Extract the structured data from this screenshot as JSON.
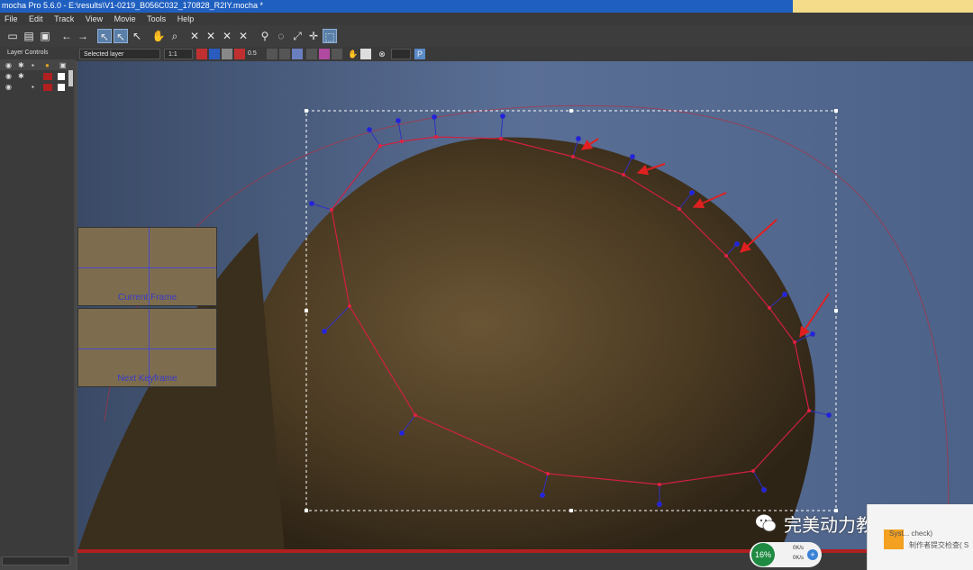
{
  "window": {
    "title": "mocha Pro 5.6.0 - E:\\results\\V1-0219_B056C032_170828_R2IY.mocha *"
  },
  "menu": [
    "File",
    "Edit",
    "Track",
    "View",
    "Movie",
    "Tools",
    "Help"
  ],
  "toolbar": {
    "layer_mode": "Selected layer",
    "zoom": "1:1",
    "opacity": "0.5",
    "p_button": "P"
  },
  "layer_controls": {
    "title": "Layer Controls"
  },
  "insets": {
    "current_frame": "Current Frame",
    "next_keyframe": "Next Keyframe"
  },
  "watermark": {
    "text": "完美动力教育"
  },
  "notification": {
    "line1": "Syst... check)",
    "line2": "制作者提交检查( S"
  },
  "speed_widget": {
    "percent": "16%",
    "upload": "0K/s",
    "download": "0K/s"
  },
  "icons": [
    "new-icon",
    "open-icon",
    "save-icon",
    "undo-icon",
    "redo-icon",
    "pick-icon",
    "select-point-icon",
    "add-point-icon",
    "pan-icon",
    "zoom-icon",
    "create-xspline-icon",
    "create-bezier-icon",
    "link-icon",
    "lasso-icon",
    "scale-icon",
    "move-icon",
    "surface-icon"
  ]
}
